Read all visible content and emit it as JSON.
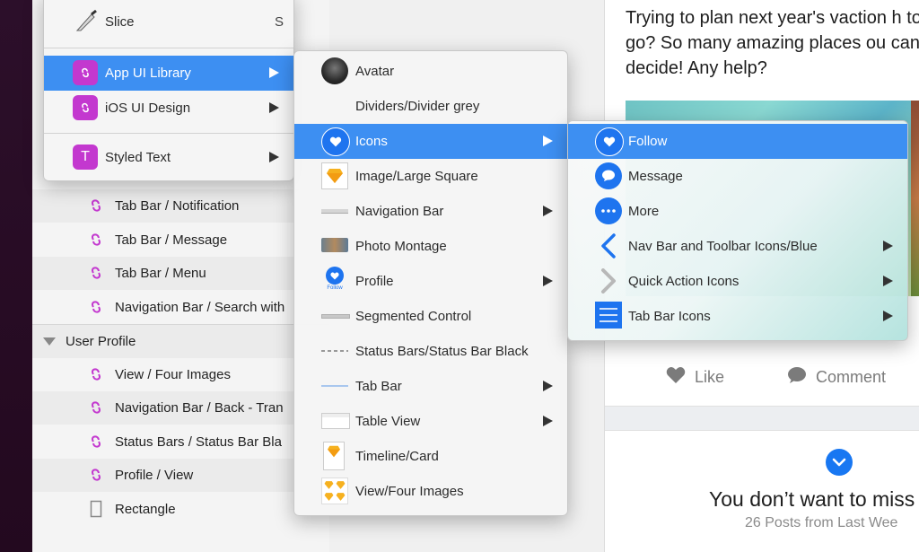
{
  "layers": {
    "rows": [
      {
        "label": "Tab Bar / Notification"
      },
      {
        "label": "Tab Bar / Message"
      },
      {
        "label": "Tab Bar / Menu"
      },
      {
        "label": "Navigation Bar / Search with"
      },
      {
        "label": "User Profile",
        "group": true
      },
      {
        "label": "View / Four Images"
      },
      {
        "label": "Navigation Bar / Back - Tran"
      },
      {
        "label": "Status Bars / Status Bar Bla"
      },
      {
        "label": "Profile / View"
      },
      {
        "label": "Rectangle"
      }
    ]
  },
  "menu1": {
    "slice": {
      "label": "Slice",
      "key": "S"
    },
    "app_ui": {
      "label": "App UI Library"
    },
    "ios_ui": {
      "label": "iOS UI Design"
    },
    "styled_text": {
      "label": "Styled Text"
    }
  },
  "menu2": {
    "items": [
      {
        "label": "Avatar"
      },
      {
        "label": "Dividers/Divider grey"
      },
      {
        "label": "Icons"
      },
      {
        "label": "Image/Large Square"
      },
      {
        "label": "Navigation Bar"
      },
      {
        "label": "Photo Montage"
      },
      {
        "label": "Profile"
      },
      {
        "label": "Segmented Control"
      },
      {
        "label": "Status Bars/Status Bar Black"
      },
      {
        "label": "Tab Bar"
      },
      {
        "label": "Table View"
      },
      {
        "label": "Timeline/Card"
      },
      {
        "label": "View/Four Images"
      }
    ],
    "profile_icon_caption": "Follow"
  },
  "menu3": {
    "items": [
      {
        "label": "Follow"
      },
      {
        "label": "Message"
      },
      {
        "label": "More"
      },
      {
        "label": "Nav Bar and Toolbar Icons/Blue"
      },
      {
        "label": "Quick Action Icons"
      },
      {
        "label": "Tab Bar Icons"
      }
    ]
  },
  "artboard": {
    "post_text": "Trying to plan next year's vaction h to go? So many amazing places ou can't decide! Any help?",
    "like": "Like",
    "comment": "Comment",
    "miss_title": "You don’t want to miss",
    "miss_sub": "26 Posts from Last Wee"
  },
  "colors": {
    "accent": "#3d8ff2",
    "brand_blue": "#1877f2",
    "symbol_pink": "#c338cf"
  }
}
